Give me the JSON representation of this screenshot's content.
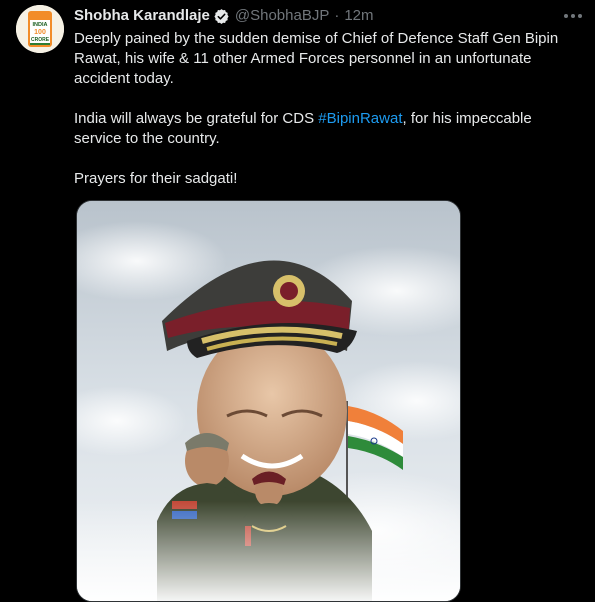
{
  "author": {
    "name": "Shobha Karandlaje",
    "handle": "@ShobhaBJP",
    "separator": "·",
    "time": "12m",
    "verified": true,
    "avatar_badge": {
      "line1": "INDIA",
      "line2": "100",
      "line3": "CRORE"
    }
  },
  "tweet": {
    "para1": "Deeply pained by the sudden demise of Chief of Defence Staff Gen Bipin Rawat, his wife & 11 other Armed Forces personnel in an unfortunate accident today.",
    "para2_before": "India will always be grateful for CDS ",
    "para2_hashtag": "#BipinRawat",
    "para2_after": ", for his impeccable service to the country.",
    "para3": "Prayers for their sadgati!"
  },
  "icons": {
    "verified": "verified-badge-icon",
    "more": "more-options-icon"
  },
  "colors": {
    "background": "#000000",
    "text": "#e7e9ea",
    "muted": "#71767b",
    "link": "#1d9bf0"
  }
}
